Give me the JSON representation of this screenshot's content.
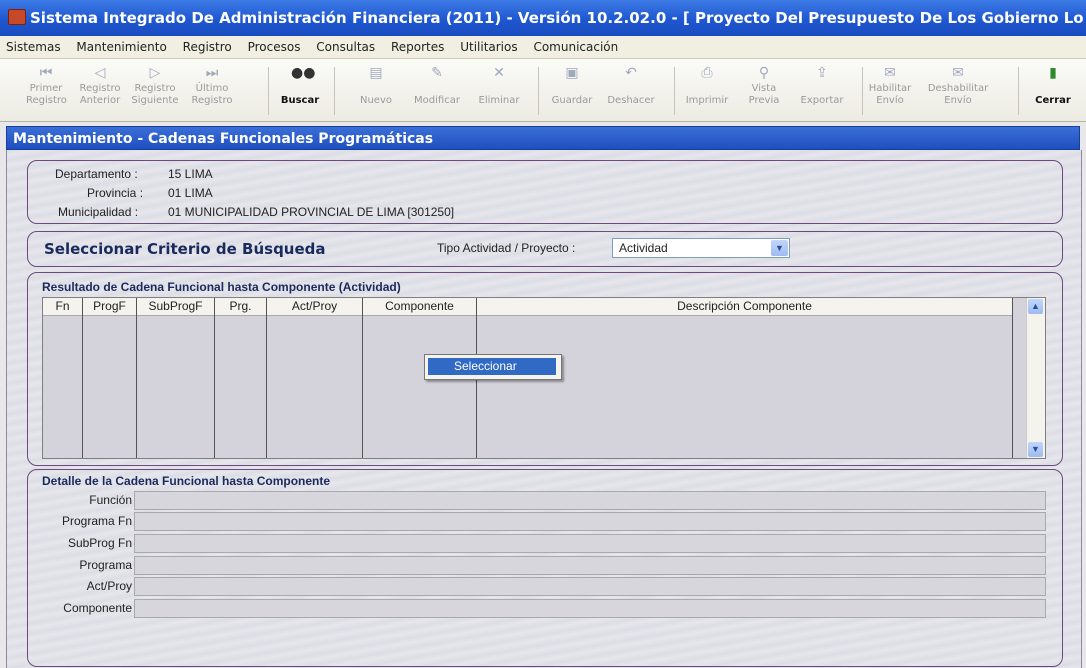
{
  "window": {
    "title": "Sistema Integrado De Administración Financiera (2011) - Versión 10.2.02.0 - [ Proyecto Del Presupuesto De Los Gobierno Lo"
  },
  "menu": [
    "Sistemas",
    "Mantenimiento",
    "Registro",
    "Procesos",
    "Consultas",
    "Reportes",
    "Utilitarios",
    "Comunicación"
  ],
  "toolbar": {
    "primer": [
      "Primer",
      "Registro"
    ],
    "anterior": [
      "Registro",
      "Anterior"
    ],
    "siguiente": [
      "Registro",
      "Siguiente"
    ],
    "ultimo": [
      "Último",
      "Registro"
    ],
    "buscar": "Buscar",
    "nuevo": "Nuevo",
    "modificar": "Modificar",
    "eliminar": "Eliminar",
    "guardar": "Guardar",
    "deshacer": "Deshacer",
    "imprimir": "Imprimir",
    "vista": [
      "Vista",
      "Previa"
    ],
    "exportar": "Exportar",
    "habilitar": [
      "Habilitar",
      "Envío"
    ],
    "deshabilitar": [
      "Deshabilitar",
      "Envío"
    ],
    "cerrar": "Cerrar"
  },
  "panel": {
    "title": "Mantenimiento - Cadenas Funcionales Programáticas"
  },
  "location": {
    "departamento_label": "Departamento :",
    "departamento_value": "15  LIMA",
    "provincia_label": "Provincia :",
    "provincia_value": "01  LIMA",
    "municipalidad_label": "Municipalidad :",
    "municipalidad_value": "01  MUNICIPALIDAD PROVINCIAL DE LIMA [301250]"
  },
  "search": {
    "title": "Seleccionar Criterio de Búsqueda",
    "tipo_label": "Tipo Actividad / Proyecto :",
    "tipo_value": "Actividad"
  },
  "results": {
    "title": "Resultado de Cadena Funcional hasta Componente (Actividad)",
    "columns": [
      "Fn",
      "ProgF",
      "SubProgF",
      "Prg.",
      "Act/Proy",
      "Componente",
      "Descripción Componente"
    ],
    "context_menu_item": "Seleccionar"
  },
  "detail": {
    "title": "Detalle de la Cadena Funcional hasta Componente",
    "fields": [
      "Función",
      "Programa Fn",
      "SubProg Fn",
      "Programa",
      "Act/Proy",
      "Componente"
    ]
  }
}
